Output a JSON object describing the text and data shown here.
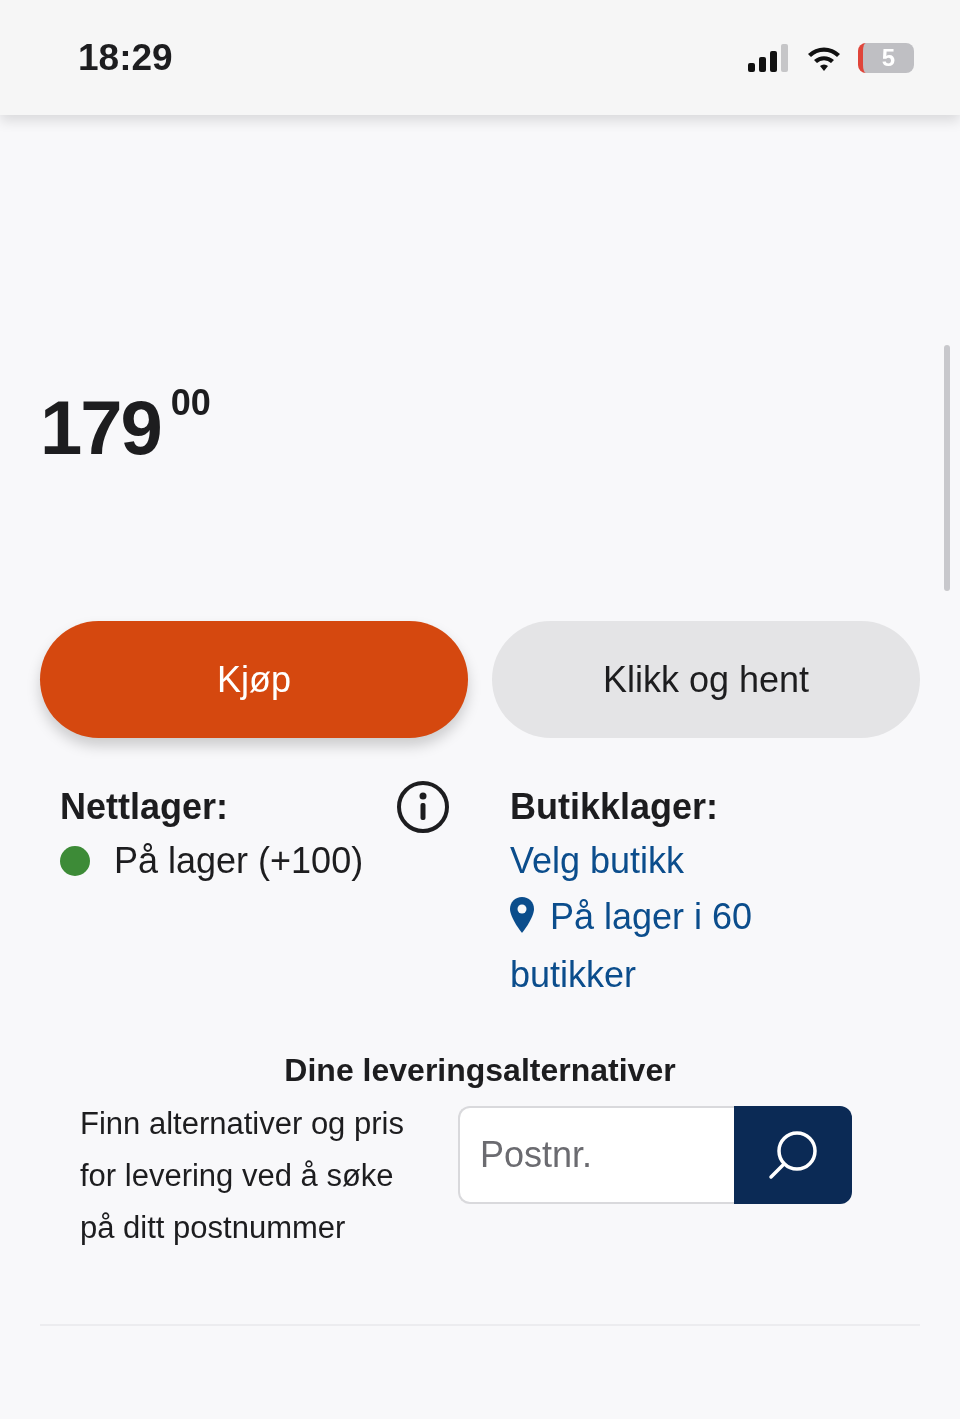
{
  "status_bar": {
    "time": "18:29",
    "battery": "5"
  },
  "price": {
    "main": "179",
    "cents": "00"
  },
  "buttons": [
    {
      "label": "Kjøp",
      "kind": "primary"
    },
    {
      "label": "Klikk og hent",
      "kind": "secondary"
    }
  ],
  "online_stock": {
    "title": "Nettlager:",
    "status": "På lager (+100)"
  },
  "store_stock": {
    "title": "Butikklager:",
    "link": "Velg butikk",
    "availability": "På lager i 60 butikker"
  },
  "delivery": {
    "title": "Dine leveringsalternativer",
    "text": "Finn alternativer og pris for levering ved å søke på ditt postnummer",
    "placeholder": "Postnr."
  }
}
